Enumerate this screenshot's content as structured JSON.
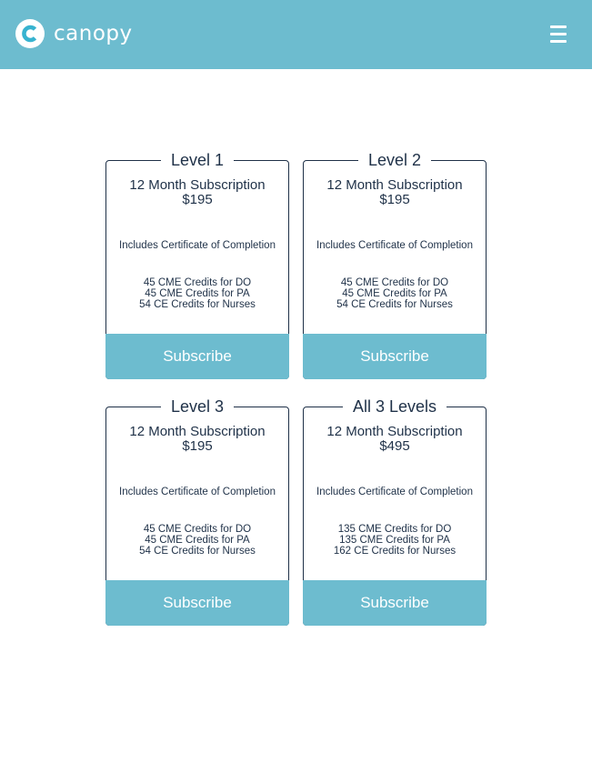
{
  "header": {
    "brand": "canopy",
    "bg_color": "#6dbccf",
    "logo_icon": "canopy-logo-icon",
    "menu_icon": "hamburger-menu-icon"
  },
  "plans": [
    {
      "title": "Level 1",
      "subscription": "12 Month Subscription",
      "price": "$195",
      "certificate": "Includes Certificate of Completion",
      "credits": [
        "45 CME Credits for DO",
        "45 CME Credits for PA",
        "54 CE Credits for Nurses"
      ],
      "button_label": "Subscribe"
    },
    {
      "title": "Level 2",
      "subscription": "12 Month Subscription",
      "price": "$195",
      "certificate": "Includes Certificate of Completion",
      "credits": [
        "45 CME Credits for DO",
        "45 CME Credits for PA",
        "54 CE Credits for Nurses"
      ],
      "button_label": "Subscribe"
    },
    {
      "title": "Level 3",
      "subscription": "12 Month Subscription",
      "price": "$195",
      "certificate": "Includes Certificate of Completion",
      "credits": [
        "45 CME Credits for DO",
        "45 CME Credits for PA",
        "54 CE Credits for Nurses"
      ],
      "button_label": "Subscribe"
    },
    {
      "title": "All 3 Levels",
      "subscription": "12 Month Subscription",
      "price": "$495",
      "certificate": "Includes Certificate of Completion",
      "credits": [
        "135 CME Credits for DO",
        "135 CME Credits for PA",
        "162 CE Credits for Nurses"
      ],
      "button_label": "Subscribe"
    }
  ],
  "colors": {
    "accent": "#6dbccf",
    "text": "#1f3148",
    "background": "#ffffff"
  }
}
